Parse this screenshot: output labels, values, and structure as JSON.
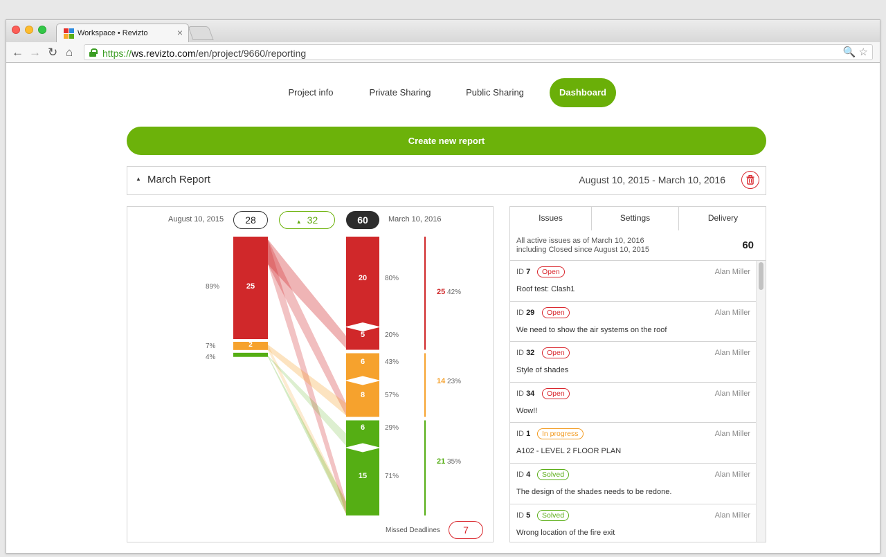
{
  "browser": {
    "tab_title": "Workspace • Revizto",
    "tab_close": "×",
    "url_scheme": "https://",
    "url_host": "ws.revizto.com",
    "url_path": "/en/project/9660/reporting",
    "nav_icons": {
      "back": "←",
      "forward": "→",
      "reload": "↻",
      "home": "⌂"
    },
    "addr_icons": "🔍 ☆"
  },
  "nav": {
    "tabs": [
      {
        "label": "Project info"
      },
      {
        "label": "Private Sharing"
      },
      {
        "label": "Public Sharing"
      },
      {
        "label": "Dashboard",
        "active": true
      }
    ]
  },
  "create_button": "Create new report",
  "report": {
    "caret": "▲",
    "title": "March Report",
    "date_range": "August 10, 2015 - March 10, 2016",
    "trash_icon": "trash-icon"
  },
  "chart_data": {
    "type": "sankey",
    "start_date": "August 10, 2015",
    "end_date": "March 10, 2016",
    "start_total": "28",
    "change": "32",
    "change_icon": "▲",
    "end_total": "60",
    "start_bars": [
      {
        "value": 25,
        "label": "25",
        "pct": "89%",
        "color": "#d0282a"
      },
      {
        "value": 2,
        "label": "2",
        "pct": "7%",
        "color": "#f6a22d"
      },
      {
        "value": 1,
        "label": "",
        "pct": "4%",
        "color": "#55ae14"
      }
    ],
    "end_bars": [
      {
        "value": 20,
        "label": "20",
        "pct": "80%",
        "color": "#d0282a"
      },
      {
        "value": 5,
        "label": "5",
        "pct": "20%",
        "color": "#d0282a"
      },
      {
        "value": 6,
        "label": "6",
        "pct": "43%",
        "color": "#f6a22d"
      },
      {
        "value": 8,
        "label": "8",
        "pct": "57%",
        "color": "#f6a22d"
      },
      {
        "value": 6,
        "label": "6",
        "pct": "29%",
        "color": "#55ae14"
      },
      {
        "value": 15,
        "label": "15",
        "pct": "71%",
        "color": "#55ae14"
      }
    ],
    "groups": [
      {
        "value": "25",
        "pct": "42%",
        "color": "#d0282a"
      },
      {
        "value": "14",
        "pct": "23%",
        "color": "#f6a22d"
      },
      {
        "value": "21",
        "pct": "35%",
        "color": "#55ae14"
      }
    ],
    "missed_label": "Missed Deadlines",
    "missed_value": "7"
  },
  "issues_panel": {
    "tabs": [
      {
        "label": "Issues",
        "active": true
      },
      {
        "label": "Settings"
      },
      {
        "label": "Delivery"
      }
    ],
    "summary_line1": "All active issues as of March 10, 2016",
    "summary_line2": "including Closed since August 10, 2015",
    "summary_count": "60",
    "items": [
      {
        "id_label": "ID",
        "id": "7",
        "status": "Open",
        "status_color": "#d9262c",
        "author": "Alan Miller",
        "title": "Roof test: Clash1"
      },
      {
        "id_label": "ID",
        "id": "29",
        "status": "Open",
        "status_color": "#d9262c",
        "author": "Alan Miller",
        "title": "We need to show the air systems on the roof"
      },
      {
        "id_label": "ID",
        "id": "32",
        "status": "Open",
        "status_color": "#d9262c",
        "author": "Alan Miller",
        "title": "Style of shades"
      },
      {
        "id_label": "ID",
        "id": "34",
        "status": "Open",
        "status_color": "#d9262c",
        "author": "Alan Miller",
        "title": "Wow!!"
      },
      {
        "id_label": "ID",
        "id": "1",
        "status": "In progress",
        "status_color": "#f39a1e",
        "author": "Alan Miller",
        "title": "A102 - LEVEL 2 FLOOR PLAN"
      },
      {
        "id_label": "ID",
        "id": "4",
        "status": "Solved",
        "status_color": "#5bae17",
        "author": "Alan Miller",
        "title": "The design of the shades needs to be redone."
      },
      {
        "id_label": "ID",
        "id": "5",
        "status": "Solved",
        "status_color": "#5bae17",
        "author": "Alan Miller",
        "title": "Wrong location of the fire exit"
      }
    ]
  }
}
